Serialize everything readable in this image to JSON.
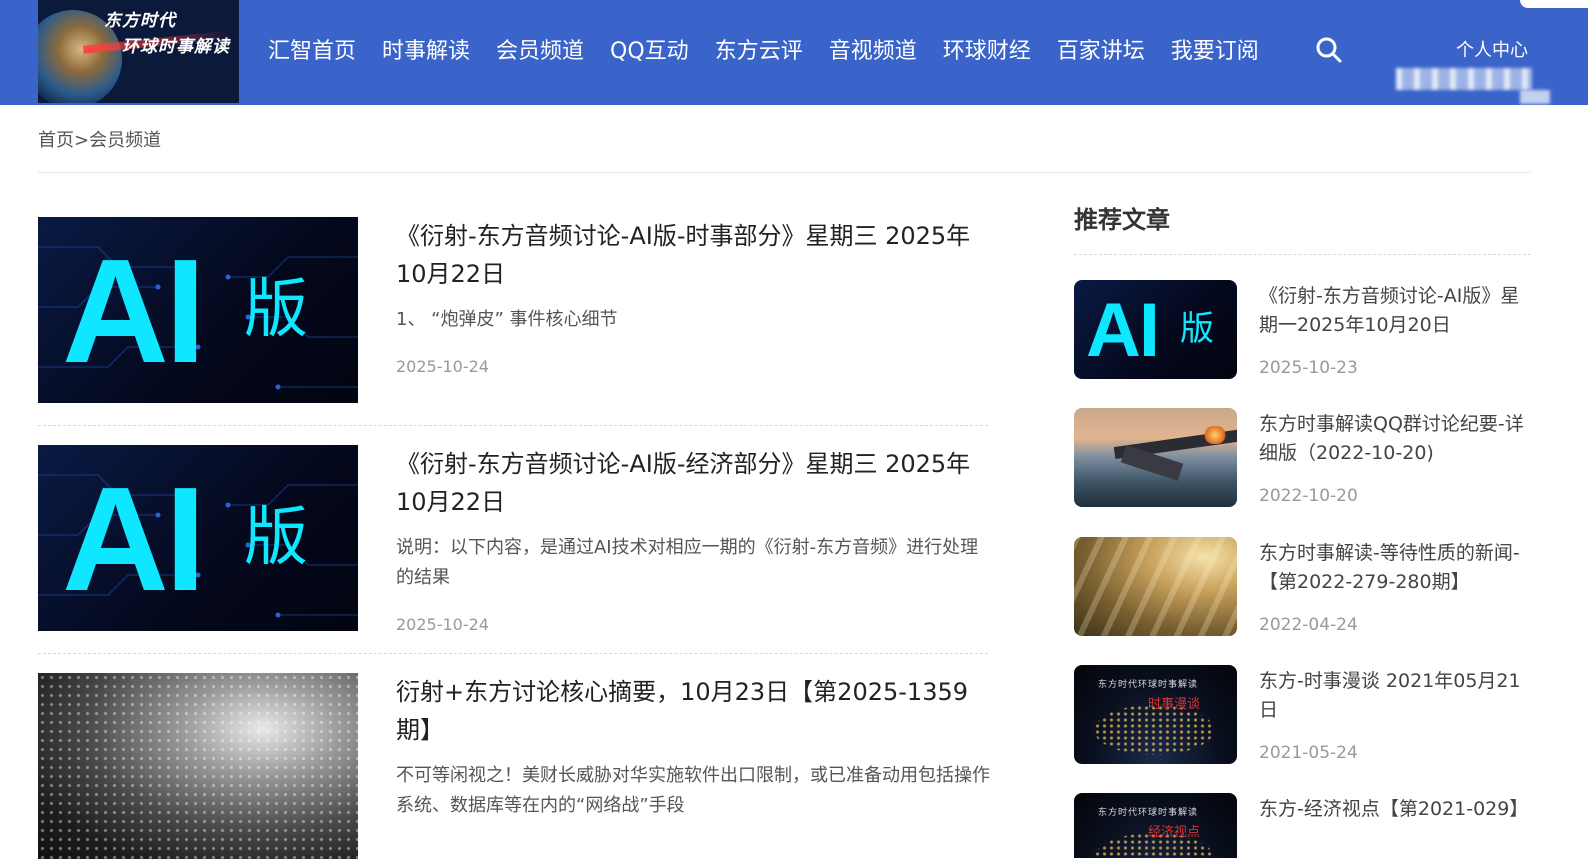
{
  "header": {
    "logo_line1": "东方时代",
    "logo_line2": "环球时事解读",
    "nav": [
      "汇智首页",
      "时事解读",
      "会员频道",
      "QQ互动",
      "东方云评",
      "音视频道",
      "环球财经",
      "百家讲坛",
      "我要订阅"
    ],
    "search_icon": "search-icon",
    "user_center": "个人中心"
  },
  "breadcrumb": {
    "home": "首页",
    "separator": ">",
    "current": "会员频道"
  },
  "articles": [
    {
      "thumb_text": "AI",
      "thumb_suffix": "版",
      "title": "《衍射-东方音频讨论-AI版-时事部分》星期三 2025年10月22日",
      "summary": "1、 “炮弹皮” 事件核心细节",
      "date": "2025-10-24"
    },
    {
      "thumb_text": "AI",
      "thumb_suffix": "版",
      "title": "《衍射-东方音频讨论-AI版-经济部分》星期三 2025年10月22日",
      "summary": "说明：以下内容，是通过AI技术对相应一期的《衍射-东方音频》进行处理的结果",
      "date": "2025-10-24"
    },
    {
      "title": "衍射+东方讨论核心摘要，10月23日【第2025-1359期】",
      "summary": "不可等闲视之！美财长威胁对华实施软件出口限制，或已准备动用包括操作系统、数据库等在内的“网络战”手段"
    }
  ],
  "sidebar": {
    "title": "推荐文章",
    "items": [
      {
        "thumb_text": "AI",
        "thumb_suffix": "版",
        "title": "《衍射-东方音频讨论-AI版》星期一2025年10月20日",
        "date": "2025-10-23"
      },
      {
        "title": "东方时事解读QQ群讨论纪要-详细版（2022-10-20)",
        "date": "2022-10-20"
      },
      {
        "title": "东方时事解读-等待性质的新闻-【第2022-279-280期】",
        "date": "2022-04-24"
      },
      {
        "thumb_caption": "东方时代环球时事解读",
        "thumb_label": "时事漫谈",
        "title": "东方-时事漫谈 2021年05月21日",
        "date": "2021-05-24"
      },
      {
        "thumb_caption": "东方时代环球时事解读",
        "thumb_label": "经济视点",
        "title": "东方-经济视点【第2021-029】"
      }
    ]
  },
  "colors": {
    "header_bg": "#3a64c9",
    "ai_cyan": "#0ee7ff"
  }
}
